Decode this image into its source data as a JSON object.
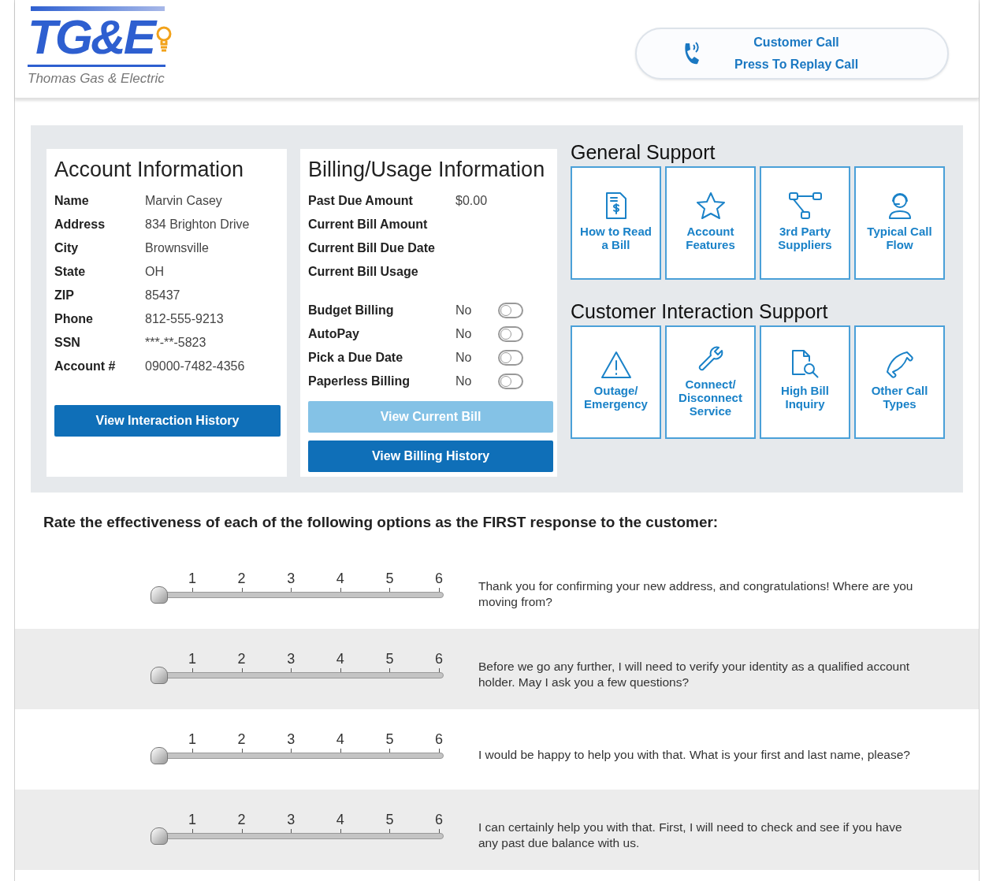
{
  "header": {
    "logo_mark": "TG&E",
    "company": "Thomas Gas & Electric",
    "call_button": {
      "title": "Customer Call",
      "subtitle": "Press To Replay Call"
    }
  },
  "account": {
    "title": "Account Information",
    "fields": [
      {
        "label": "Name",
        "value": "Marvin Casey"
      },
      {
        "label": "Address",
        "value": "834 Brighton Drive"
      },
      {
        "label": "City",
        "value": "Brownsville"
      },
      {
        "label": "State",
        "value": "OH"
      },
      {
        "label": "ZIP",
        "value": "85437"
      },
      {
        "label": "Phone",
        "value": "812-555-9213"
      },
      {
        "label": "SSN",
        "value": "***-**-5823"
      },
      {
        "label": "Account #",
        "value": "09000-7482-4356"
      }
    ],
    "button": "View Interaction History"
  },
  "billing": {
    "title": "Billing/Usage Information",
    "fields": [
      {
        "label": "Past Due Amount",
        "value": "$0.00"
      },
      {
        "label": "Current Bill Amount"
      },
      {
        "label": "Current Bill Due Date"
      },
      {
        "label": "Current Bill Usage"
      }
    ],
    "options": [
      {
        "label": "Budget Billing",
        "value": "No",
        "on": false
      },
      {
        "label": "AutoPay",
        "value": "No",
        "on": false
      },
      {
        "label": "Pick a Due Date",
        "value": "No",
        "on": false
      },
      {
        "label": "Paperless Billing",
        "value": "No",
        "on": false
      }
    ],
    "buttons": [
      {
        "label": "View Current Bill",
        "disabled": true
      },
      {
        "label": "View Billing History",
        "disabled": false
      }
    ]
  },
  "support_sections": [
    {
      "title": "General Support",
      "tiles": [
        {
          "label": "How to Read a Bill"
        },
        {
          "label": "Account Features"
        },
        {
          "label": "3rd Party Suppliers"
        },
        {
          "label": "Typical Call Flow"
        }
      ]
    },
    {
      "title": "Customer Interaction Support",
      "tiles": [
        {
          "label": "Outage/ Emergency"
        },
        {
          "label": "Connect/ Disconnect Service"
        },
        {
          "label": "High Bill Inquiry"
        },
        {
          "label": "Other Call Types"
        }
      ]
    }
  ],
  "rating": {
    "prompt": "Rate the effectiveness of each of the following options as the FIRST response to the customer:",
    "items": [
      {
        "ticks": [
          "1",
          "2",
          "3",
          "4",
          "5",
          "6"
        ],
        "text": "Thank you for confirming your new address, and congratulations! Where are you moving from?",
        "level": 0
      },
      {
        "ticks": [
          "1",
          "2",
          "3",
          "4",
          "5",
          "6"
        ],
        "text": "Before we go any further, I will need to verify your identity as a qualified account holder. May I ask you a few questions?",
        "level": 0
      },
      {
        "ticks": [
          "1",
          "2",
          "3",
          "4",
          "5",
          "6"
        ],
        "text": "I would be happy to help you with that. What is your first and last name, please?",
        "level": 0
      },
      {
        "ticks": [
          "1",
          "2",
          "3",
          "4",
          "5",
          "6"
        ],
        "text": "I can certainly help you with that. First, I will need to check and see if you have any past due balance with us.",
        "level": 0
      }
    ]
  }
}
